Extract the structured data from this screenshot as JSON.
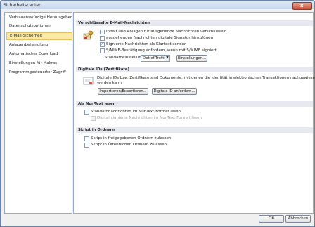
{
  "window": {
    "title": "Sicherheitscenter",
    "close_glyph": "x"
  },
  "sidebar": {
    "items": [
      {
        "label": "Vertrauenswürdige Herausgeber"
      },
      {
        "label": "Datenschutzoptionen"
      },
      {
        "label": "E-Mail-Sicherheit"
      },
      {
        "label": "Anlagenbehandlung"
      },
      {
        "label": "Automatischer Download"
      },
      {
        "label": "Einstellungen für Makros"
      },
      {
        "label": "Programmgesteuerter Zugriff"
      }
    ],
    "selected_index": 2
  },
  "sections": {
    "encrypted": {
      "title": "Verschlüsselte E-Mail-Nachrichten",
      "options": [
        {
          "label": "Inhalt und Anlagen für ausgehende Nachrichten verschlüsseln",
          "checked": false
        },
        {
          "label": "ausgehenden Nachrichten digitale Signatur hinzufügen",
          "checked": false
        },
        {
          "label": "Signierte Nachrichten als Klartext senden",
          "checked": true
        },
        {
          "label": "S/MIME-Bestätigung anfordern, wenn mit S/MIME signiert",
          "checked": false
        }
      ],
      "default_setting_label": "Standardeinstellung:",
      "default_setting_value": "Detlef.Trettin",
      "settings_button": "Einstellungen..."
    },
    "digital_ids": {
      "title": "Digitale IDs (Zertifikate)",
      "description_line1": "Digitale IDs bzw. Zertifikate sind Dokumente, mit denen die Identität in elektronischen Transaktionen nachgewiesen",
      "description_line2": "werden kann.",
      "import_button": "Importieren/Exportieren...",
      "get_id_button": "Digitale ID anfordern..."
    },
    "plain_text": {
      "title": "Als Nur-Text lesen",
      "options": [
        {
          "label": "Standardnachrichten im Nur-Text-Format lesen",
          "checked": false,
          "disabled": false
        },
        {
          "label": "Digital signierte Nachrichten im Nur-Text-Format lesen",
          "checked": false,
          "disabled": true
        }
      ]
    },
    "script": {
      "title": "Skript in Ordnern",
      "options": [
        {
          "label": "Skript in freigegebenen Ordnern zulassen",
          "checked": false
        },
        {
          "label": "Skript in Öffentlichen Ordnern zulassen",
          "checked": false
        }
      ]
    }
  },
  "footer": {
    "ok": "OK",
    "cancel": "Abbrechen"
  }
}
